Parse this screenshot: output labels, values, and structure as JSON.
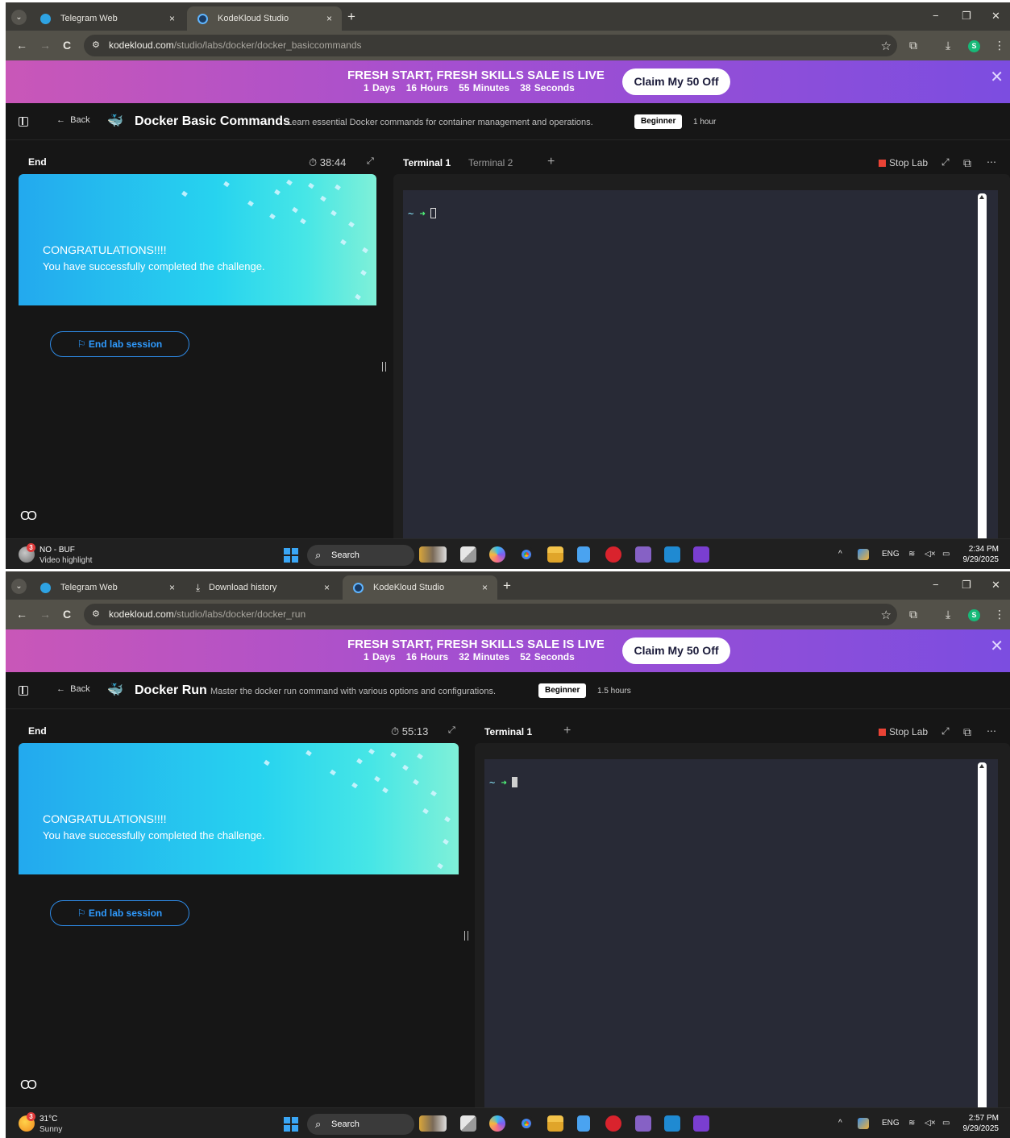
{
  "screens": [
    {
      "tabs": [
        {
          "label": "Telegram Web",
          "close": "×"
        },
        {
          "label": "KodeKloud Studio",
          "close": "×"
        }
      ],
      "url_host": "kodekloud.com",
      "url_path": "/studio/labs/docker/docker_basiccommands",
      "promo": {
        "title": "FRESH START, FRESH SKILLS SALE IS LIVE",
        "days": "1 Days",
        "hours": "16 Hours",
        "minutes": "55 Minutes",
        "seconds": "38 Seconds",
        "cta": "Claim My 50 Off"
      },
      "lab": {
        "back": "Back",
        "title": "Docker Basic Commands",
        "description": "Learn essential Docker commands for container management and operations.",
        "level": "Beginner",
        "duration": "1 hour"
      },
      "panel": {
        "end": "End",
        "timer": "38:44",
        "congrats_title": "CONGRATULATIONS!!!!",
        "congrats_message": "You have successfully completed the challenge.",
        "end_session": "End lab session"
      },
      "terminal": {
        "tabs": [
          "Terminal 1",
          "Terminal 2"
        ],
        "stop": "Stop Lab",
        "prompt_dir": "~",
        "prompt_arrow": "➜"
      },
      "taskbar": {
        "widget_line1": "NO - BUF",
        "widget_line2": "Video highlight",
        "widget_badge": "3",
        "search": "Search",
        "lang": "ENG",
        "time": "2:34 PM",
        "date": "9/29/2025"
      }
    },
    {
      "tabs": [
        {
          "label": "Telegram Web",
          "close": "×"
        },
        {
          "label": "Download history",
          "close": "×"
        },
        {
          "label": "KodeKloud Studio",
          "close": "×"
        }
      ],
      "url_host": "kodekloud.com",
      "url_path": "/studio/labs/docker/docker_run",
      "promo": {
        "title": "FRESH START, FRESH SKILLS SALE IS LIVE",
        "days": "1 Days",
        "hours": "16 Hours",
        "minutes": "32 Minutes",
        "seconds": "52 Seconds",
        "cta": "Claim My 50 Off"
      },
      "lab": {
        "back": "Back",
        "title": "Docker Run",
        "description": "Master the docker run command with various options and configurations.",
        "level": "Beginner",
        "duration": "1.5 hours"
      },
      "panel": {
        "end": "End",
        "timer": "55:13",
        "congrats_title": "CONGRATULATIONS!!!!",
        "congrats_message": "You have successfully completed the challenge.",
        "end_session": "End lab session"
      },
      "terminal": {
        "tabs": [
          "Terminal 1"
        ],
        "stop": "Stop Lab",
        "prompt_dir": "~",
        "prompt_arrow": "➜"
      },
      "taskbar": {
        "widget_line1": "31°C",
        "widget_line2": "Sunny",
        "widget_badge": "3",
        "search": "Search",
        "lang": "ENG",
        "time": "2:57 PM",
        "date": "9/29/2025"
      }
    }
  ],
  "icons": {
    "tab_menu": "⌄",
    "new_tab": "+",
    "minimize": "−",
    "restore": "❐",
    "close_window": "✕",
    "back_nav": "←",
    "forward_nav": "→",
    "reload": "C",
    "site_settings": "⚙",
    "bookmark": "☆",
    "extensions": "⧉",
    "download": "⤓",
    "menu": "⋮",
    "profile": "S",
    "promo_close": "✕",
    "lab_back": "←",
    "docker": "🐳",
    "timer": "⏱",
    "expand": "⤢",
    "flag": "⚐",
    "captions": "CO",
    "open_external": "⧉",
    "more": "⋯",
    "search": "⌕",
    "tray_up": "^",
    "wifi": "≋",
    "volume": "◁×",
    "battery": "▭"
  },
  "colors": {
    "accent_blue": "#2f9bff",
    "stop_red": "#ea4335",
    "prompt_green": "#50fa7b"
  }
}
